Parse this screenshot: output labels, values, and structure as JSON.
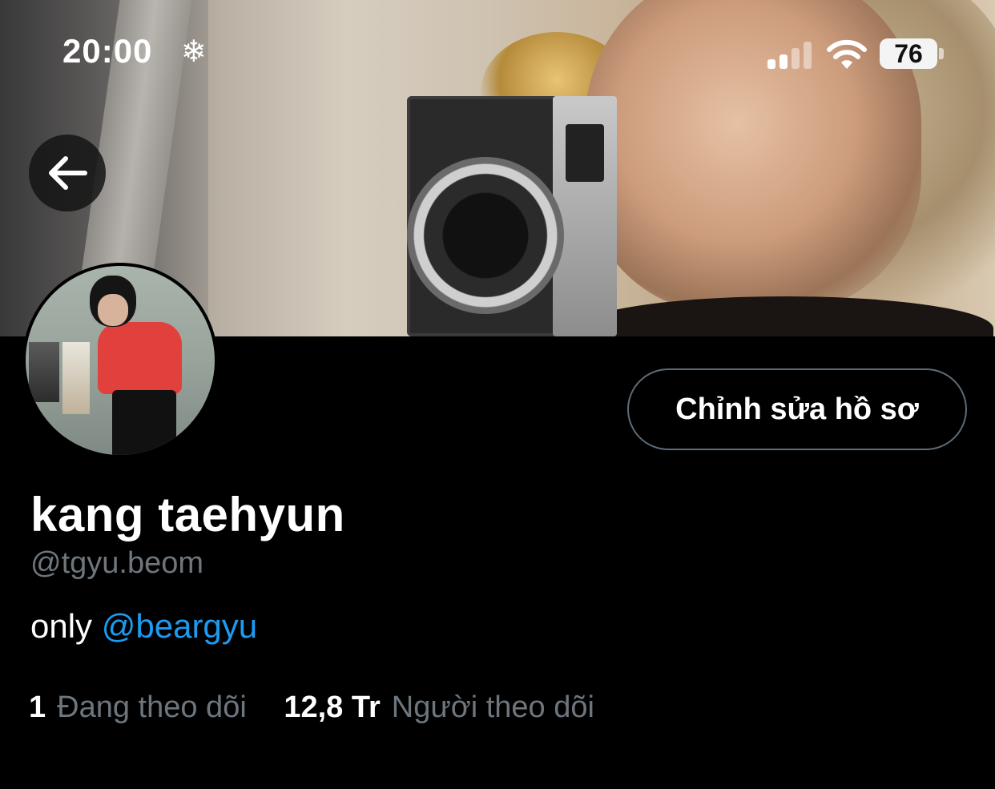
{
  "status_bar": {
    "time": "20:00",
    "focus_icon": "snowflake-icon",
    "battery": "76"
  },
  "header": {
    "back_icon": "arrow-left-icon"
  },
  "profile": {
    "edit_button": "Chỉnh sửa hồ sơ",
    "display_name": "kang taehyun",
    "handle": "@tgyu.beom",
    "bio_text": "only",
    "bio_mention": "@beargyu",
    "following_count": "1",
    "following_label": "Đang theo dõi",
    "followers_count": "12,8 Tr",
    "followers_label": "Người theo dõi"
  },
  "colors": {
    "background": "#000000",
    "link": "#1d9bf0",
    "muted_text": "#6e767d",
    "button_border": "#5f6b76"
  }
}
